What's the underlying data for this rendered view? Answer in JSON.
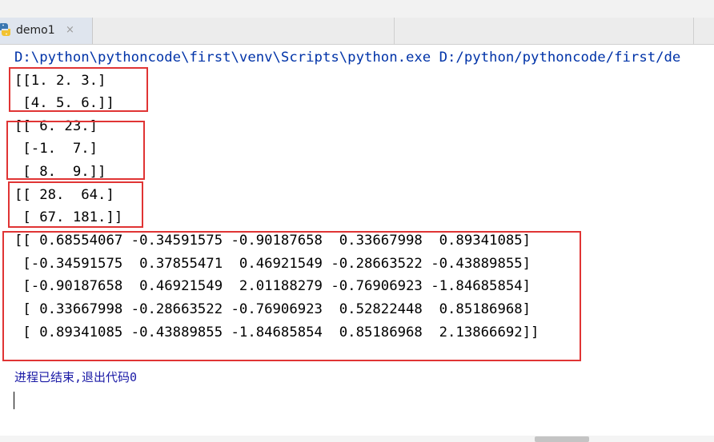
{
  "editor_tab": {
    "label": "demo1",
    "close_glyph": "×",
    "icon": "python-file-icon"
  },
  "console": {
    "command": "D:\\python\\pythoncode\\first\\venv\\Scripts\\python.exe D:/python/pythoncode/first/de",
    "output_blocks": [
      [
        "[[1. 2. 3.]",
        " [4. 5. 6.]]"
      ],
      [
        "[[ 6. 23.]",
        " [-1.  7.]",
        " [ 8.  9.]]"
      ],
      [
        "[[ 28.  64.]",
        " [ 67. 181.]]"
      ],
      [
        "[[ 0.68554067 -0.34591575 -0.90187658  0.33667998  0.89341085]",
        " [-0.34591575  0.37855471  0.46921549 -0.28663522 -0.43889855]",
        " [-0.90187658  0.46921549  2.01188279 -0.76906923 -1.84685854]",
        " [ 0.33667998 -0.28663522 -0.76906923  0.52822448  0.85186968]",
        " [ 0.89341085 -0.43889855 -1.84685854  0.85186968  2.13866692]]"
      ]
    ],
    "exit_message": "进程已结束,退出代码0"
  },
  "colors": {
    "command_text": "#0033a8",
    "output_text": "#000000",
    "exit_text": "#1a1aa6",
    "highlight_box": "#e03434"
  }
}
